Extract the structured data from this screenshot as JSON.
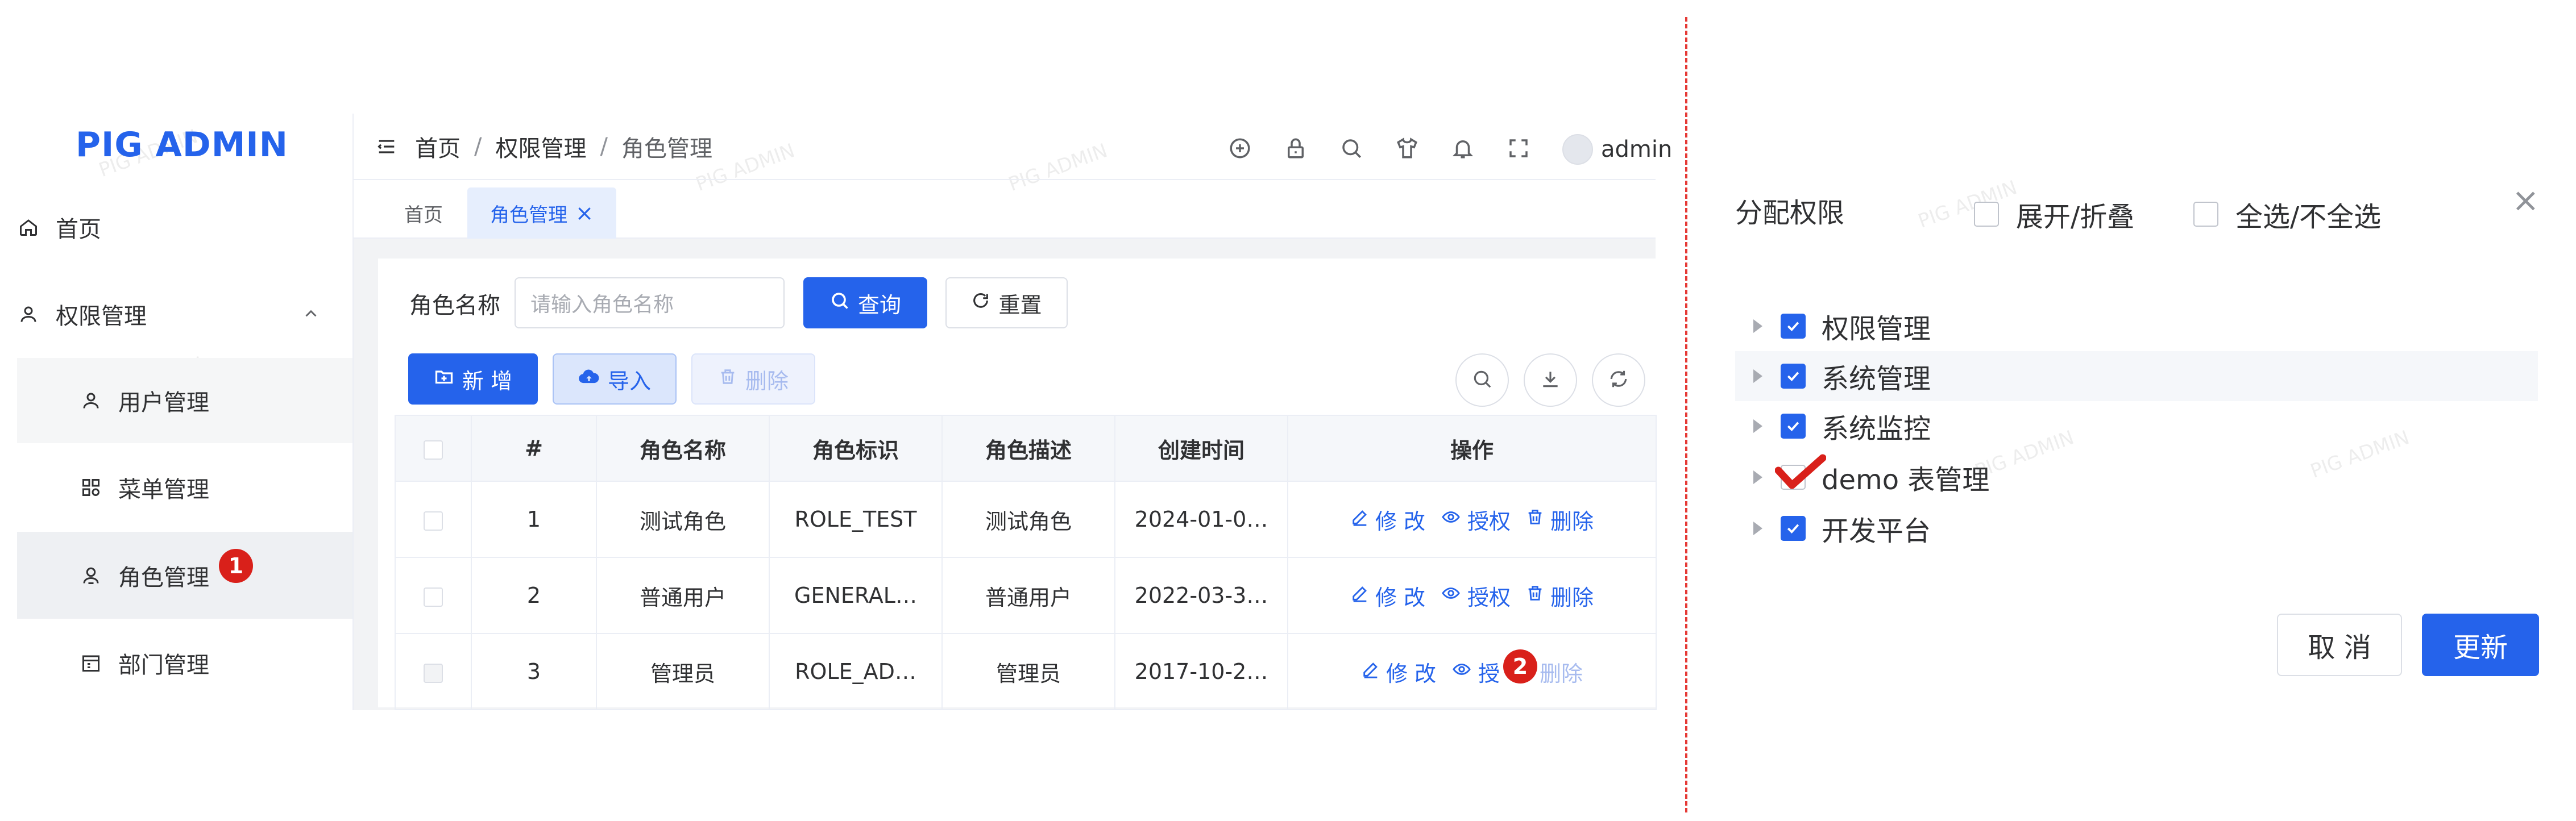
{
  "app": {
    "logo": "PIG ADMIN",
    "watermark": "PIG ADMIN"
  },
  "sidebar": {
    "items": [
      {
        "label": "首页"
      },
      {
        "label": "权限管理"
      },
      {
        "label": "用户管理"
      },
      {
        "label": "菜单管理"
      },
      {
        "label": "角色管理",
        "step": "1"
      },
      {
        "label": "部门管理"
      }
    ]
  },
  "header": {
    "breadcrumb": [
      "首页",
      "权限管理",
      "角色管理"
    ],
    "separator": "/",
    "user": "admin"
  },
  "tabs": [
    {
      "label": "首页"
    },
    {
      "label": "角色管理",
      "close": "×"
    }
  ],
  "search": {
    "label": "角色名称",
    "placeholder": "请输入角色名称",
    "query_btn": "查询",
    "reset_btn": "重置"
  },
  "toolbar": {
    "add": "新 增",
    "import": "导入",
    "delete": "删除"
  },
  "table": {
    "columns": [
      "#",
      "角色名称",
      "角色标识",
      "角色描述",
      "创建时间",
      "操作"
    ],
    "rows": [
      {
        "no": "1",
        "name": "测试角色",
        "code": "ROLE_TEST",
        "desc": "测试角色",
        "time": "2024-01-0…"
      },
      {
        "no": "2",
        "name": "普通用户",
        "code": "GENERAL…",
        "desc": "普通用户",
        "time": "2022-03-3…"
      },
      {
        "no": "3",
        "name": "管理员",
        "code": "ROLE_AD…",
        "desc": "管理员",
        "time": "2017-10-2…"
      }
    ],
    "actions": {
      "edit": "修 改",
      "auth": "授权",
      "auth_short": "授",
      "delete": "删除"
    },
    "step2": "2"
  },
  "dialog": {
    "title": "分配权限",
    "expand": "展开/折叠",
    "select_all": "全选/不全选",
    "close": "×",
    "tree": [
      {
        "label": "权限管理",
        "checked": true
      },
      {
        "label": "系统管理",
        "checked": true
      },
      {
        "label": "系统监控",
        "checked": true
      },
      {
        "label": "demo 表管理",
        "checked": false,
        "tick_mark": true
      },
      {
        "label": "开发平台",
        "checked": true
      }
    ],
    "cancel": "取 消",
    "update": "更新"
  },
  "colors": {
    "primary": "#2563eb",
    "badge": "#d9201a",
    "divider": "#e53935"
  }
}
